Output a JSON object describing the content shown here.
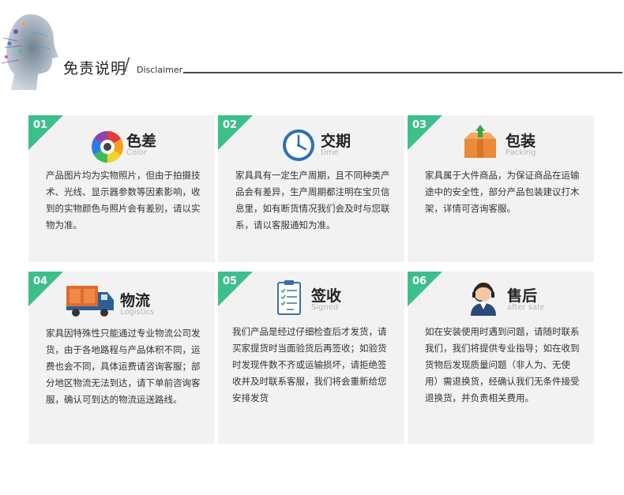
{
  "header": {
    "title_cn": "免责说明",
    "slash": "/",
    "title_en": "Disclaimer"
  },
  "cards": [
    {
      "num": "01",
      "title": "色差",
      "subtitle": "Color",
      "icon": "color-wheel-icon",
      "text": "产品图片均为实物照片，但由于拍摄技术、光线、显示器参数等因素影响，收到的实物颜色与照片会有差别，请以实物为准。"
    },
    {
      "num": "02",
      "title": "交期",
      "subtitle": "time",
      "icon": "clock-icon",
      "text": "家具具有一定生产周期，且不同种类产品会有差异，生产周期都注明在宝贝信息里，如有断货情况我们会及时与您联系，请以客服通知为准。"
    },
    {
      "num": "03",
      "title": "包装",
      "subtitle": "Packing",
      "icon": "box-icon",
      "text": "家具属于大件商品，为保证商品在运输途中的安全性，部分产品包装建议打木架，详情可咨询客服。"
    },
    {
      "num": "04",
      "title": "物流",
      "subtitle": "Logistics",
      "icon": "truck-icon",
      "text": "家具因特殊性只能通过专业物流公司发货，由于各地路程与产品体积不同，运费也会不同，具体运费请咨询客服；部分地区物流无法到达，请下单前咨询客服，确认可到达的物流运送路线。"
    },
    {
      "num": "05",
      "title": "签收",
      "subtitle": "Signed",
      "icon": "clipboard-icon",
      "text": "我们产品是经过仔细检查后才发货，请买家提货时当面验货后再签收；如验货时发现件数不齐或运输损坏，请拒绝签收并及时联系客服，我们将会重新给您安排发货"
    },
    {
      "num": "06",
      "title": "售后",
      "subtitle": "after sale",
      "icon": "headset-agent-icon",
      "text": "如在安装使用时遇到问题，请随时联系我们，我们将提供专业指导；如在收到货物后发现质量问题（非人为、无使用）需退换货，经确认我们无条件接受退换货，并负责相关费用。"
    }
  ],
  "colors": {
    "accent": "#3dbf8c",
    "card_bg": "#f2f2f2",
    "rule": "#3f4a57"
  }
}
